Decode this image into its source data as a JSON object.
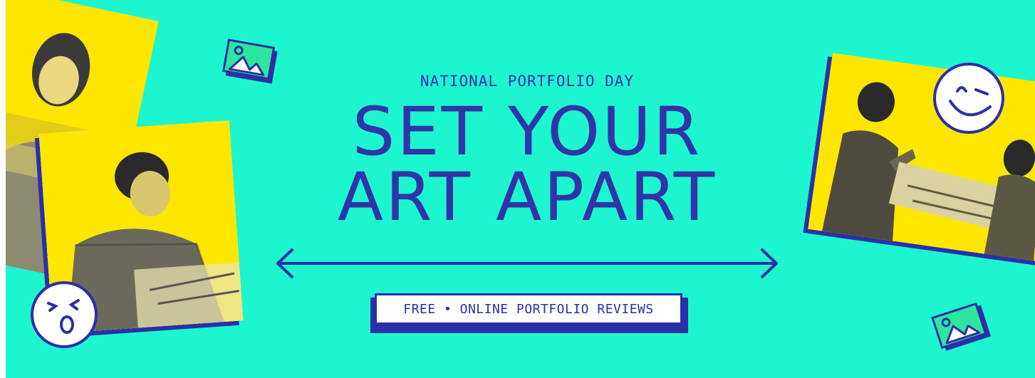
{
  "banner": {
    "kicker": "NATIONAL PORTFOLIO DAY",
    "headline_line1": "SET YOUR",
    "headline_line2": "ART APART",
    "badge": "FREE • ONLINE PORTFOLIO REVIEWS"
  },
  "colors": {
    "background": "#1df5cf",
    "accent_blue": "#2b2fa8",
    "photo_yellow": "#ffe600",
    "icon_green": "#2ee59d",
    "white": "#ffffff"
  },
  "icons": [
    "image-icon",
    "winking-face-icon",
    "surprised-face-icon",
    "double-arrow-icon"
  ]
}
